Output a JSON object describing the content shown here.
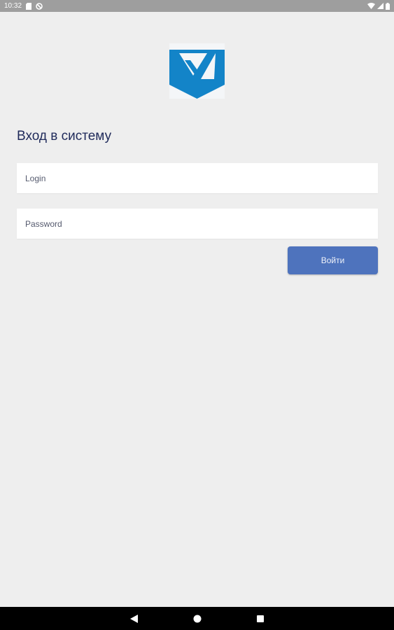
{
  "status_bar": {
    "time": "10:32",
    "icons": [
      "sd-card-icon",
      "no-sync-icon",
      "wifi-icon",
      "signal-icon",
      "battery-icon"
    ]
  },
  "logo": {
    "icon": "brand-logo-icon",
    "colors": {
      "primary": "#1384c8",
      "background": "#f4f6f8"
    }
  },
  "login_form": {
    "title": "Вход в систему",
    "login_placeholder": "Login",
    "login_value": "",
    "password_placeholder": "Password",
    "password_value": "",
    "submit_label": "Войти"
  },
  "nav_bar": {
    "icons": [
      "back-icon",
      "home-icon",
      "recents-icon"
    ]
  },
  "colors": {
    "background": "#eeeeee",
    "title": "#1f2a5a",
    "button": "#4e73bd",
    "status_bar": "#9e9e9e",
    "nav_bar": "#000000"
  }
}
